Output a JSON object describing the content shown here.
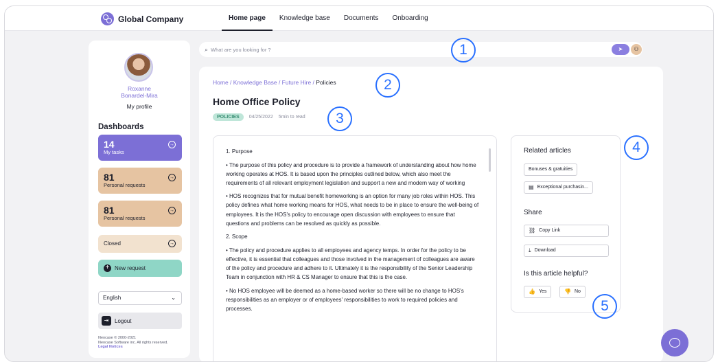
{
  "app": {
    "logo_text": "Global Company"
  },
  "nav": {
    "items": [
      "Home page",
      "Knowledge base",
      "Documents",
      "Onboarding"
    ],
    "active": "Home page"
  },
  "sidebar": {
    "user_name_line1": "Roxanne",
    "user_name_line2": "Bonardel-Mira",
    "profile_link": "My profile",
    "dashboards_title": "Dashboards",
    "cards": [
      {
        "num": "14",
        "label": "My tasks"
      },
      {
        "num": "81",
        "label": "Personal requests"
      },
      {
        "num": "81",
        "label": "Personal requests"
      },
      {
        "num": "",
        "label": "Closed"
      }
    ],
    "new_request": "New request",
    "language": "English",
    "logout": "Logout",
    "legal_line1": "Neocase © 2000-2021",
    "legal_line2": "Neocase Software inc. All rights reserved.",
    "legal_link": "Legal Notices"
  },
  "search": {
    "placeholder": "What are you looking for ?"
  },
  "breadcrumb": {
    "items": [
      "Home",
      "Knowledge Base",
      "Future Hire"
    ],
    "current": "Policies"
  },
  "article": {
    "title": "Home Office Policy",
    "tag": "POLICIES",
    "date": "04/25/2022",
    "read_time": "5min to read",
    "paragraphs": [
      "1. Purpose",
      "• The purpose of this policy and procedure is to provide a framework of understanding about how home working operates at HOS. It is based upon the principles outlined below, which also meet the requirements of all relevant employment legislation and support a new and modern way of working",
      "• HOS  recognizes  that for mutual benefit homeworking is an option for many job roles within HOS. This policy defines what home working means for HOS, what needs to be in place to ensure the well-being of employees. It is the HOS's policy to encourage open discussion with employees to ensure that questions and problems can be resolved as quickly as possible.",
      "2. Scope",
      "• The policy and procedure applies to all employees and agency temps.  In order for  the policy to be effective, it is essential that colleagues and those involved in the management of colleagues are aware of the policy and procedure and adhere to it. Ultimately it is the responsibility of the Senior Leadership Team in conjunction with HR & CS Manager to ensure that this is the case.",
      "• No HOS employee will be deemed as a home-based worker so there will be no change to HOS's responsibilities as an employer or of employees' responsibilities to work to required policies and processes."
    ]
  },
  "aside": {
    "related_title": "Related articles",
    "related": [
      "Bonuses & gratuities",
      "Exceptional purchasin..."
    ],
    "share_title": "Share",
    "copy_link": "Copy Link",
    "download": "Download",
    "helpful_title": "Is this article helpful?",
    "yes": "Yes",
    "no": "No"
  },
  "annotations": [
    "1",
    "2",
    "3",
    "4",
    "5"
  ],
  "colors": {
    "accent": "#7c6fd6",
    "annotation": "#2970ff",
    "tag_bg": "#bfe6d9",
    "request_card": "#e6c4a2"
  },
  "icons": {
    "search": "search-icon",
    "send": "send-icon",
    "people": "people-icon",
    "arrow": "arrow-right-circle-icon",
    "link": "link-icon",
    "download": "download-icon",
    "thumbs_up": "thumbs-up-icon",
    "thumbs_down": "thumbs-down-icon",
    "chat": "chat-icon"
  }
}
